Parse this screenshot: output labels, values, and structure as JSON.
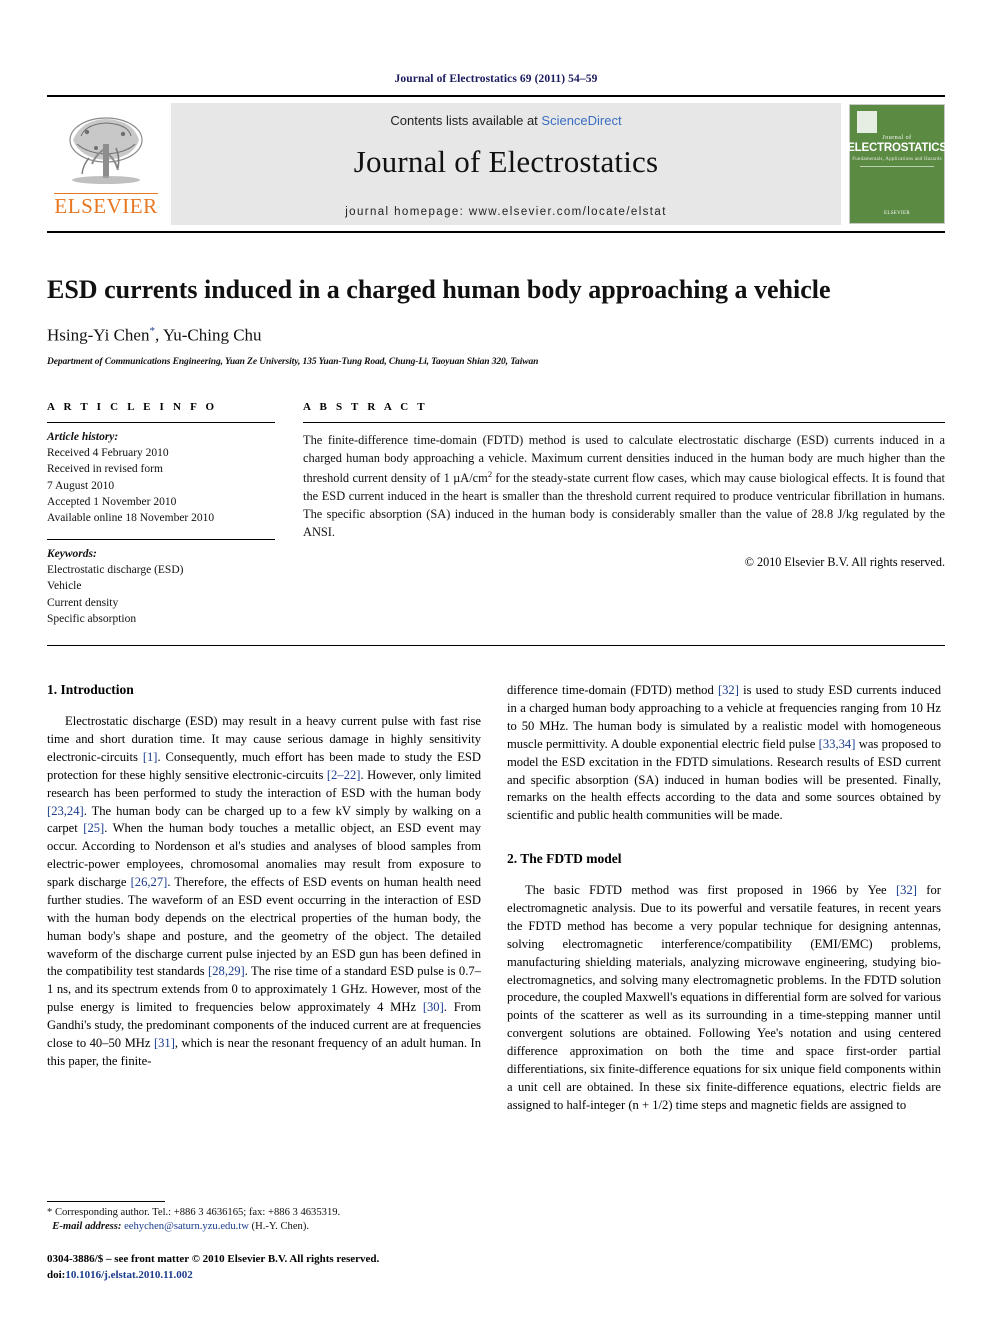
{
  "running_head": "Journal of Electrostatics 69 (2011) 54–59",
  "masthead": {
    "elsevier_wordmark": "ELSEVIER",
    "contents_prefix": "Contents lists available at ",
    "sciencedirect": "ScienceDirect",
    "journal_name": "Journal of Electrostatics",
    "homepage": "journal homepage: www.elsevier.com/locate/elstat",
    "cover": {
      "small_top": "Journal of",
      "title": "ELECTROSTATICS",
      "subtitle": "Fundamentals, Applications and Hazards",
      "foot": "ELSEVIER"
    },
    "accent_green": "#5b8a43",
    "accent_orange": "#E87722",
    "link_blue": "#3b6ec3"
  },
  "article": {
    "title": "ESD currents induced in a charged human body approaching a vehicle",
    "authors": "Hsing-Yi Chen",
    "author_marker": "*",
    "authors_rest": ", Yu-Ching Chu",
    "affiliation": "Department of Communications Engineering, Yuan Ze University, 135 Yuan-Tung Road, Chung-Li, Taoyuan Shian 320, Taiwan"
  },
  "info": {
    "label": "A R T I C L E   I N F O",
    "history_label": "Article history:",
    "history": [
      "Received 4 February 2010",
      "Received in revised form",
      "7 August 2010",
      "Accepted 1 November 2010",
      "Available online 18 November 2010"
    ],
    "keywords_label": "Keywords:",
    "keywords": [
      "Electrostatic discharge (ESD)",
      "Vehicle",
      "Current density",
      "Specific absorption"
    ]
  },
  "abstract": {
    "label": "A B S T R A C T",
    "text_part1": "The finite-difference time-domain (FDTD) method is used to calculate electrostatic discharge (ESD) currents induced in a charged human body approaching a vehicle. Maximum current densities induced in the human body are much higher than the threshold current density of 1 µA/cm",
    "superscript": "2",
    "text_part2": " for the steady-state current flow cases, which may cause biological effects. It is found that the ESD current induced in the heart is smaller than the threshold current required to produce ventricular fibrillation in humans. The specific absorption (SA) induced in the human body is considerably smaller than the value of 28.8 J/kg regulated by the ANSI.",
    "copyright": "© 2010 Elsevier B.V. All rights reserved."
  },
  "sections": {
    "intro_heading": "1. Introduction",
    "fdtd_heading": "2. The FDTD model"
  },
  "body": {
    "left_p1_a": "Electrostatic discharge (ESD) may result in a heavy current pulse with fast rise time and short duration time. It may cause serious damage in highly sensitivity electronic-circuits ",
    "left_ref1": "[1]",
    "left_p1_b": ". Consequently, much effort has been made to study the ESD protection for these highly sensitive electronic-circuits ",
    "left_ref2": "[2–22]",
    "left_p1_c": ". However, only limited research has been performed to study the interaction of ESD with the human body ",
    "left_ref3": "[23,24]",
    "left_p1_d": ". The human body can be charged up to a few kV simply by walking on a carpet ",
    "left_ref4": "[25]",
    "left_p1_e": ". When the human body touches a metallic object, an ESD event may occur. According to Nordenson et al's studies and analyses of blood samples from electric-power employees, chromosomal anomalies may result from exposure to spark discharge ",
    "left_ref5": "[26,27]",
    "left_p1_f": ". Therefore, the effects of ESD events on human health need further studies. The waveform of an ESD event occurring in the interaction of ESD with the human body depends on the electrical properties of the human body, the human body's shape and posture, and the geometry of the object. The detailed waveform of the discharge current pulse injected by an ESD gun has been defined in the compatibility test standards ",
    "left_ref6": "[28,29]",
    "left_p1_g": ". The rise time of a standard ESD pulse is 0.7–1 ns, and its spectrum extends from 0 to approximately 1 GHz. However, most of the pulse energy is limited to frequencies below approximately 4 MHz ",
    "left_ref7": "[30]",
    "left_p1_h": ". From Gandhi's study, the predominant components of the induced current are at frequencies close to 40–50 MHz ",
    "left_ref8": "[31]",
    "left_p1_i": ", which is near the resonant frequency of an adult human. In this paper, the finite-",
    "right_p1_a": "difference time-domain (FDTD) method ",
    "right_ref1": "[32]",
    "right_p1_b": " is used to study ESD currents induced in a charged human body approaching to a vehicle at frequencies ranging from 10 Hz to 50 MHz. The human body is simulated by a realistic model with homogeneous muscle permittivity. A double exponential electric field pulse ",
    "right_ref2": "[33,34]",
    "right_p1_c": " was proposed to model the ESD excitation in the FDTD simulations. Research results of ESD current and specific absorption (SA) induced in human bodies will be presented. Finally, remarks on the health effects according to the data and some sources obtained by scientific and public health communities will be made.",
    "right_p2_a": "The basic FDTD method was first proposed in 1966 by Yee ",
    "right_ref3": "[32]",
    "right_p2_b": " for electromagnetic analysis. Due to its powerful and versatile features, in recent years the FDTD method has become a very popular technique for designing antennas, solving electromagnetic interference/compatibility (EMI/EMC) problems, manufacturing shielding materials, analyzing microwave engineering, studying bio-electromagnetics, and solving many electromagnetic problems. In the FDTD solution procedure, the coupled Maxwell's equations in differential form are solved for various points of the scatterer as well as its surrounding in a time-stepping manner until convergent solutions are obtained. Following Yee's notation and using centered difference approximation on both the time and space first-order partial differentiations, six finite-difference equations for six unique field components within a unit cell are obtained. In these six finite-difference equations, electric fields are assigned to half-integer (n + 1/2) time steps and magnetic fields are assigned to"
  },
  "footnote": {
    "corresponding": "* Corresponding author. Tel.: +886 3 4636165; fax: +886 3 4635319.",
    "email_label": "E-mail address:",
    "email": "eehychen@saturn.yzu.edu.tw",
    "email_suffix": " (H.-Y. Chen).",
    "issn_line": "0304-3886/$ – see front matter © 2010 Elsevier B.V. All rights reserved.",
    "doi_label": "doi:",
    "doi": "10.1016/j.elstat.2010.11.002"
  }
}
